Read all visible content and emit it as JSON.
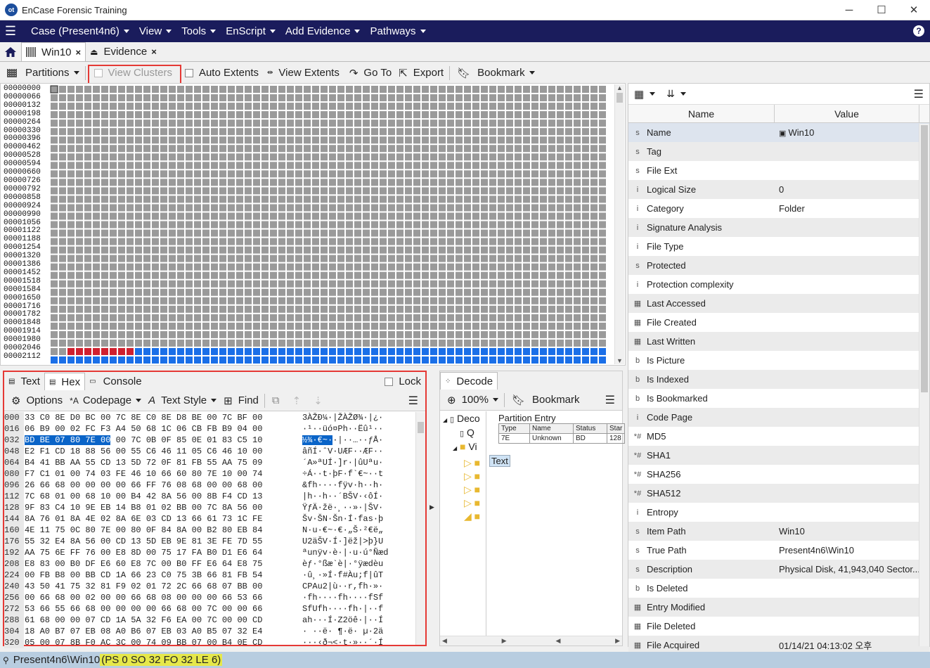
{
  "window": {
    "app_title": "EnCase Forensic Training",
    "minimize": "─",
    "maximize": "☐",
    "close": "✕",
    "logo_text": "ot"
  },
  "menu": {
    "items": [
      "Case (Present4n6)",
      "View",
      "Tools",
      "EnScript",
      "Add Evidence",
      "Pathways"
    ],
    "help": "?"
  },
  "tabs": [
    {
      "label": "Win10",
      "close": "×"
    },
    {
      "label": "Evidence",
      "close": "×"
    }
  ],
  "toolbar": {
    "partitions": "Partitions",
    "view_clusters": "View Clusters",
    "auto_extents": "Auto Extents",
    "view_extents": "View Extents",
    "go_to": "Go To",
    "export": "Export",
    "bookmark": "Bookmark"
  },
  "disk_map": {
    "offsets": [
      "00000000",
      "00000066",
      "00000132",
      "00000198",
      "00000264",
      "00000330",
      "00000396",
      "00000462",
      "00000528",
      "00000594",
      "00000660",
      "00000726",
      "00000792",
      "00000858",
      "00000924",
      "00000990",
      "00001056",
      "00001122",
      "00001188",
      "00001254",
      "00001320",
      "00001386",
      "00001452",
      "00001518",
      "00001584",
      "00001650",
      "00001716",
      "00001782",
      "00001848",
      "00001914",
      "00001980",
      "00002046",
      "00002112"
    ],
    "colors": {
      "empty": "#9a9a9a",
      "used": "#1a6fe8",
      "partition": "#d0202e"
    }
  },
  "properties": {
    "header_name": "Name",
    "header_value": "Value",
    "rows": [
      {
        "icon": "s",
        "name": "Name",
        "value": "Win10"
      },
      {
        "icon": "s",
        "name": "Tag",
        "value": ""
      },
      {
        "icon": "s",
        "name": "File Ext",
        "value": ""
      },
      {
        "icon": "i",
        "name": "Logical Size",
        "value": "0"
      },
      {
        "icon": "i",
        "name": "Category",
        "value": "Folder"
      },
      {
        "icon": "i",
        "name": "Signature Analysis",
        "value": ""
      },
      {
        "icon": "i",
        "name": "File Type",
        "value": ""
      },
      {
        "icon": "s",
        "name": "Protected",
        "value": ""
      },
      {
        "icon": "i",
        "name": "Protection complexity",
        "value": ""
      },
      {
        "icon": "▦",
        "name": "Last Accessed",
        "value": ""
      },
      {
        "icon": "▦",
        "name": "File Created",
        "value": ""
      },
      {
        "icon": "▦",
        "name": "Last Written",
        "value": ""
      },
      {
        "icon": "b",
        "name": "Is Picture",
        "value": ""
      },
      {
        "icon": "b",
        "name": "Is Indexed",
        "value": ""
      },
      {
        "icon": "b",
        "name": "Is Bookmarked",
        "value": ""
      },
      {
        "icon": "i",
        "name": "Code Page",
        "value": ""
      },
      {
        "icon": "*#",
        "name": "MD5",
        "value": ""
      },
      {
        "icon": "*#",
        "name": "SHA1",
        "value": ""
      },
      {
        "icon": "*#",
        "name": "SHA256",
        "value": ""
      },
      {
        "icon": "*#",
        "name": "SHA512",
        "value": ""
      },
      {
        "icon": "i",
        "name": "Entropy",
        "value": ""
      },
      {
        "icon": "s",
        "name": "Item Path",
        "value": "Win10"
      },
      {
        "icon": "s",
        "name": "True Path",
        "value": "Present4n6\\Win10"
      },
      {
        "icon": "s",
        "name": "Description",
        "value": "Physical Disk, 41,943,040 Sector..."
      },
      {
        "icon": "b",
        "name": "Is Deleted",
        "value": ""
      },
      {
        "icon": "▦",
        "name": "Entry Modified",
        "value": ""
      },
      {
        "icon": "▦",
        "name": "File Deleted",
        "value": ""
      },
      {
        "icon": "▦",
        "name": "File Acquired",
        "value": "01/14/21 04:13:02 오후"
      }
    ]
  },
  "hex_panel": {
    "tabs": {
      "text": "Text",
      "hex": "Hex",
      "console": "Console",
      "lock": "Lock"
    },
    "toolbar": {
      "options": "Options",
      "codepage": "Codepage",
      "text_style": "Text Style",
      "find": "Find"
    },
    "rows": [
      {
        "off": "000",
        "pre": "33 C0 8E D0 BC 00 7C 8E C0 8E D8 BE 00 7C BF 00",
        "sel": "",
        "post": "",
        "text_pre": "3ÀŽÐ¼·|ŽÀŽØ¾·|¿·",
        "text_sel": "",
        "text_post": ""
      },
      {
        "off": "016",
        "pre": "06 B9 00 02 FC F3 A4 50 68 1C 06 CB FB B9 04 00",
        "sel": "",
        "post": "",
        "text_pre": "·¹··üó¤Ph··Ëû¹··",
        "text_sel": "",
        "text_post": ""
      },
      {
        "off": "032",
        "pre": "",
        "sel": "BD BE 07 80 7E 00",
        "post": " 00 7C 0B 0F 85 0E 01 83 C5 10",
        "text_pre": "",
        "text_sel": "½¾·€~·",
        "text_post": "·|··…··ƒÅ·"
      },
      {
        "off": "048",
        "pre": "E2 F1 CD 18 88 56 00 55 C6 46 11 05 C6 46 10 00",
        "sel": "",
        "post": "",
        "text_pre": "âñÍ·ˆV·UÆF··ÆF··",
        "text_sel": "",
        "text_post": ""
      },
      {
        "off": "064",
        "pre": "B4 41 BB AA 55 CD 13 5D 72 0F 81 FB 55 AA 75 09",
        "sel": "",
        "post": "",
        "text_pre": "´A»ªUÍ·]r·|ûUªu·",
        "text_sel": "",
        "text_post": ""
      },
      {
        "off": "080",
        "pre": "F7 C1 01 00 74 03 FE 46 10 66 60 80 7E 10 00 74",
        "sel": "",
        "post": "",
        "text_pre": "÷Á··t·þF·f`€~··t",
        "text_sel": "",
        "text_post": ""
      },
      {
        "off": "096",
        "pre": "26 66 68 00 00 00 00 66 FF 76 08 68 00 00 68 00",
        "sel": "",
        "post": "",
        "text_pre": "&fh····fÿv·h··h·",
        "text_sel": "",
        "text_post": ""
      },
      {
        "off": "112",
        "pre": "7C 68 01 00 68 10 00 B4 42 8A 56 00 8B F4 CD 13",
        "sel": "",
        "post": "",
        "text_pre": "|h··h··´BŠV·‹ôÍ·",
        "text_sel": "",
        "text_post": ""
      },
      {
        "off": "128",
        "pre": "9F 83 C4 10 9E EB 14 B8 01 02 BB 00 7C 8A 56 00",
        "sel": "",
        "post": "",
        "text_pre": "ŸƒÄ·žë·¸··»·|ŠV·",
        "text_sel": "",
        "text_post": ""
      },
      {
        "off": "144",
        "pre": "8A 76 01 8A 4E 02 8A 6E 03 CD 13 66 61 73 1C FE",
        "sel": "",
        "post": "",
        "text_pre": "Šv·ŠN·Šn·Í·fas·þ",
        "text_sel": "",
        "text_post": ""
      },
      {
        "off": "160",
        "pre": "4E 11 75 0C 80 7E 00 80 0F 84 8A 00 B2 80 EB 84",
        "sel": "",
        "post": "",
        "text_pre": "N·u·€~·€·„Š·²€ë„",
        "text_sel": "",
        "text_post": ""
      },
      {
        "off": "176",
        "pre": "55 32 E4 8A 56 00 CD 13 5D EB 9E 81 3E FE 7D 55",
        "sel": "",
        "post": "",
        "text_pre": "U2äŠV·Í·]ëž|>þ}U",
        "text_sel": "",
        "text_post": ""
      },
      {
        "off": "192",
        "pre": "AA 75 6E FF 76 00 E8 8D 00 75 17 FA B0 D1 E6 64",
        "sel": "",
        "post": "",
        "text_pre": "ªunÿv·è·|·u·ú°Ñæd",
        "text_sel": "",
        "text_post": ""
      },
      {
        "off": "208",
        "pre": "E8 83 00 B0 DF E6 60 E8 7C 00 B0 FF E6 64 E8 75",
        "sel": "",
        "post": "",
        "text_pre": "èƒ·°ßæ`è|·°ÿædèu",
        "text_sel": "",
        "text_post": ""
      },
      {
        "off": "224",
        "pre": "00 FB B8 00 BB CD 1A 66 23 C0 75 3B 66 81 FB 54",
        "sel": "",
        "post": "",
        "text_pre": "·û¸·»Í·f#Àu;f|ûT",
        "text_sel": "",
        "text_post": ""
      },
      {
        "off": "240",
        "pre": "43 50 41 75 32 81 F9 02 01 72 2C 66 68 07 BB 00",
        "sel": "",
        "post": "",
        "text_pre": "CPAu2|ù··r,fh·»·",
        "text_sel": "",
        "text_post": ""
      },
      {
        "off": "256",
        "pre": "00 66 68 00 02 00 00 66 68 08 00 00 00 66 53 66",
        "sel": "",
        "post": "",
        "text_pre": "·fh····fh····fSf",
        "text_sel": "",
        "text_post": ""
      },
      {
        "off": "272",
        "pre": "53 66 55 66 68 00 00 00 00 66 68 00 7C 00 00 66",
        "sel": "",
        "post": "",
        "text_pre": "SfUfh····fh·|··f",
        "text_sel": "",
        "text_post": ""
      },
      {
        "off": "288",
        "pre": "61 68 00 00 07 CD 1A 5A 32 F6 EA 00 7C 00 00 CD",
        "sel": "",
        "post": "",
        "text_pre": "ah···Í·Z2öê·|··Í",
        "text_sel": "",
        "text_post": ""
      },
      {
        "off": "304",
        "pre": "18 A0 B7 07 EB 08 A0 B6 07 EB 03 A0 B5 07 32 E4",
        "sel": "",
        "post": "",
        "text_pre": "· ··ë· ¶·ë· µ·2ä",
        "text_sel": "",
        "text_post": ""
      },
      {
        "off": "320",
        "pre": "05 00 07 8B F0 AC 3C 00 74 09 BB 07 00 B4 0E CD",
        "sel": "",
        "post": "",
        "text_pre": "···‹ð¬<·t·»··´·Í",
        "text_sel": "",
        "text_post": ""
      }
    ]
  },
  "decode_panel": {
    "tab": "Decode",
    "zoom": "100%",
    "bookmark": "Bookmark",
    "tree_items": [
      "Deco",
      "Q",
      "Vi"
    ],
    "tooltip": "Text",
    "partition_entry": {
      "title": "Partition Entry",
      "headers": [
        "Type",
        "Name",
        "Status",
        "Star"
      ],
      "row": [
        "7E",
        "Unknown",
        "BD",
        "128"
      ]
    }
  },
  "status": {
    "path": "Present4n6\\Win10",
    "info": "(PS 0 SO 32 FO 32 LE 6)"
  }
}
